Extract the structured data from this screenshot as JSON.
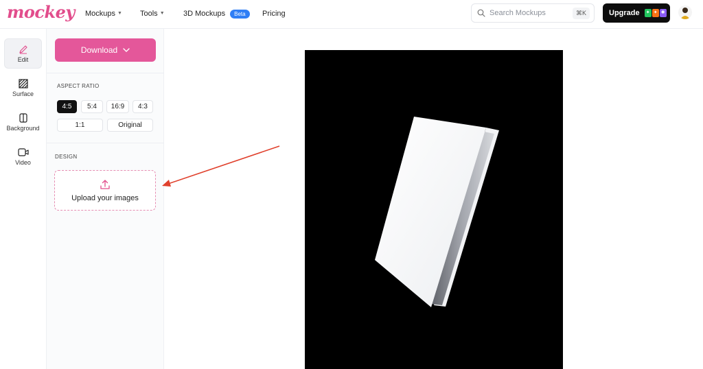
{
  "brand": {
    "logo_text": "mockey",
    "color": "#e24d8c"
  },
  "nav": {
    "items": [
      {
        "label": "Mockups",
        "has_dropdown": true
      },
      {
        "label": "Tools",
        "has_dropdown": true
      },
      {
        "label": "3D Mockups",
        "badge": "Beta"
      },
      {
        "label": "Pricing"
      }
    ]
  },
  "search": {
    "placeholder": "Search Mockups",
    "shortcut": "⌘K",
    "icon": "search-icon"
  },
  "upgrade": {
    "label": "Upgrade",
    "icon_colors": [
      "#22c55e",
      "#f97316",
      "#8b5cf6"
    ]
  },
  "rail": {
    "items": [
      {
        "label": "Edit",
        "icon": "pencil-icon",
        "active": true
      },
      {
        "label": "Surface",
        "icon": "surface-icon"
      },
      {
        "label": "Background",
        "icon": "background-icon"
      },
      {
        "label": "Video",
        "icon": "video-icon"
      }
    ]
  },
  "panel": {
    "download_label": "Download",
    "aspect_ratio_label": "ASPECT RATIO",
    "ratios": [
      "4:5",
      "5:4",
      "16:9",
      "4:3",
      "1:1",
      "Original"
    ],
    "selected_ratio": "4:5",
    "design_label": "DESIGN",
    "upload_label": "Upload your images"
  },
  "colors": {
    "accent": "#e4579a",
    "canvas_background": "#000000",
    "annotation_arrow": "#e0402c"
  }
}
